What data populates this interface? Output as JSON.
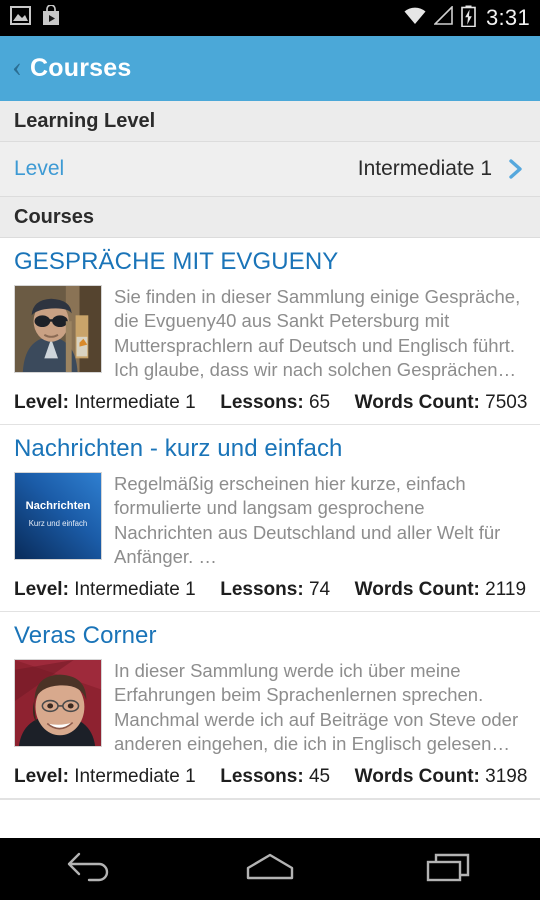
{
  "status_bar": {
    "icons_left": [
      "image-icon",
      "play-store-icon"
    ],
    "icons_right": [
      "wifi-icon",
      "cell-signal-icon",
      "battery-charging-icon"
    ],
    "time": "3:31"
  },
  "app_bar": {
    "back_label": "‹",
    "title": "Courses"
  },
  "sections": {
    "learning_level_header": "Learning Level",
    "courses_header": "Courses"
  },
  "level_row": {
    "label": "Level",
    "value": "Intermediate 1",
    "chevron": "chevron-right-icon"
  },
  "meta_labels": {
    "level": "Level:",
    "lessons": "Lessons:",
    "words_count": "Words Count:"
  },
  "courses": [
    {
      "title": "GESPRÄCHE MIT EVGUENY",
      "description": "Sie finden in dieser Sammlung einige Gespräche, die Evgueny40 aus Sankt Petersburg mit Muttersprachlern auf Deutsch und Englisch führt. Ich glaube, dass wir nach solchen Gesprächen…",
      "level": "Intermediate 1",
      "lessons": "65",
      "words_count": "7503",
      "thumbnail": "photo-man-with-cap-and-sunglasses"
    },
    {
      "title": "Nachrichten - kurz und einfach",
      "description": "Regelmäßig erscheinen hier kurze, einfach formulierte und langsam gesprochene Nachrichten aus Deutschland und aller Welt für Anfänger. …",
      "level": "Intermediate 1",
      "lessons": "74",
      "words_count": "2119",
      "thumbnail": "blue-logo-nachrichten",
      "thumbnail_text_main": "Nachrichten",
      "thumbnail_text_sub": "Kurz und einfach"
    },
    {
      "title": "Veras Corner",
      "description": "In dieser Sammlung werde ich über meine Erfahrungen beim Sprachenlernen sprechen. Manchmal werde ich auf Beiträge von Steve oder anderen eingehen, die ich in Englisch gelesen…",
      "level": "Intermediate 1",
      "lessons": "45",
      "words_count": "3198",
      "thumbnail": "photo-woman-with-glasses"
    }
  ],
  "nav_bar": {
    "back": "back-icon",
    "home": "home-icon",
    "recents": "recents-icon"
  },
  "colors": {
    "accent_blue": "#4ba8d8",
    "link_blue": "#1a74b8",
    "level_blue": "#3d9ad4",
    "section_bg": "#ececec",
    "description_gray": "#8d8d8d"
  }
}
